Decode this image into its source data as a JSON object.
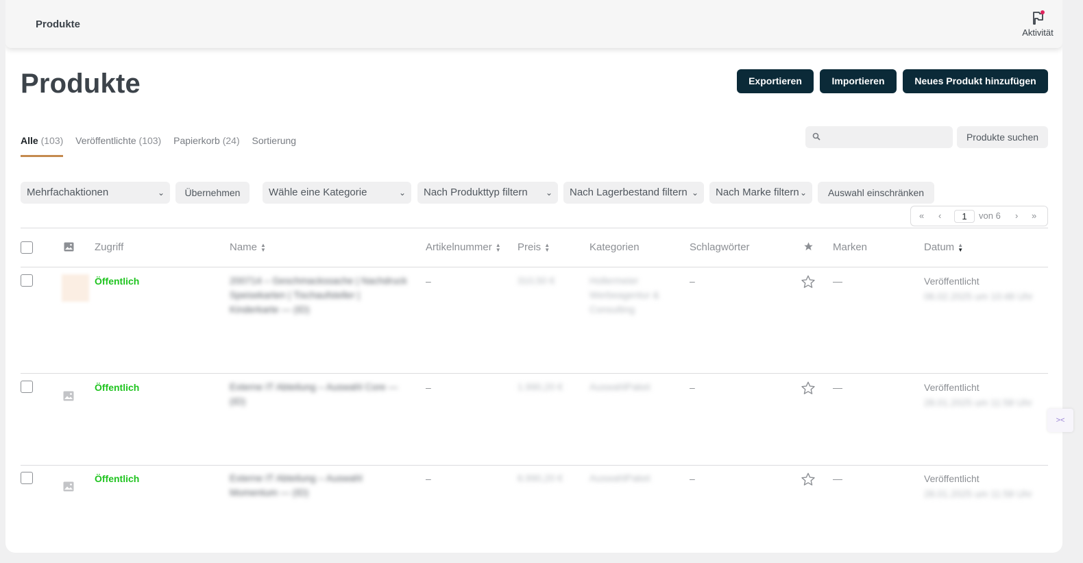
{
  "topbar": {
    "title": "Produkte",
    "activity_label": "Aktivität"
  },
  "page": {
    "title": "Produkte"
  },
  "actions": {
    "export": "Exportieren",
    "import": "Importieren",
    "add_new": "Neues Produkt hinzufügen"
  },
  "tabs": [
    {
      "label": "Alle",
      "count": "(103)"
    },
    {
      "label": "Veröffentlichte",
      "count": "(103)"
    },
    {
      "label": "Papierkorb",
      "count": "(24)"
    },
    {
      "label": "Sortierung",
      "count": ""
    }
  ],
  "search": {
    "placeholder": "",
    "button": "Produkte suchen"
  },
  "filters": {
    "bulk": "Mehrfachaktionen",
    "apply": "Übernehmen",
    "category": "Wähle eine Kategorie",
    "product_type": "Nach Produkttyp filtern",
    "stock": "Nach Lagerbestand filtern",
    "brand": "Nach Marke filtern",
    "restrict": "Auswahl einschränken"
  },
  "pagination": {
    "first": "«",
    "prev": "‹",
    "current": "1",
    "of_label": "von 6",
    "next": "›",
    "last": "»"
  },
  "columns": {
    "access": "Zugriff",
    "name": "Name",
    "sku": "Artikelnummer",
    "price": "Preis",
    "categories": "Kategorien",
    "tags": "Schlagwörter",
    "brands": "Marken",
    "date": "Datum"
  },
  "rows": [
    {
      "status": "Öffentlich",
      "name": "200714 – Geschmackssache | Nachdruck Speisekarten | Tischaufsteller | Kinderkarte — (ID)",
      "sku": "–",
      "price": "310,50 €",
      "categories": "Hollermeier Werbeagentur & Consulting",
      "tags": "–",
      "brands": "—",
      "date_label": "Veröffentlicht",
      "date_value": "06.02.2025 um 10:48 Uhr"
    },
    {
      "status": "Öffentlich",
      "name": "Externe IT Abteilung – Auswahl Core — (ID)",
      "sku": "–",
      "price": "1.990,20 €",
      "categories": "AuswahlPaket",
      "tags": "–",
      "brands": "—",
      "date_label": "Veröffentlicht",
      "date_value": "28.01.2025 um 11:58 Uhr"
    },
    {
      "status": "Öffentlich",
      "name": "Externe IT Abteilung – Auswahl Momentum — (ID)",
      "sku": "–",
      "price": "6.990,20 €",
      "categories": "AuswahlPaket",
      "tags": "–",
      "brands": "—",
      "date_label": "Veröffentlicht",
      "date_value": "28.01.2025 um 11:58 Uhr"
    }
  ],
  "colors": {
    "primary_button": "#0b2a38",
    "status_public": "#1ec31e",
    "active_tab_underline": "#c48a4e"
  }
}
